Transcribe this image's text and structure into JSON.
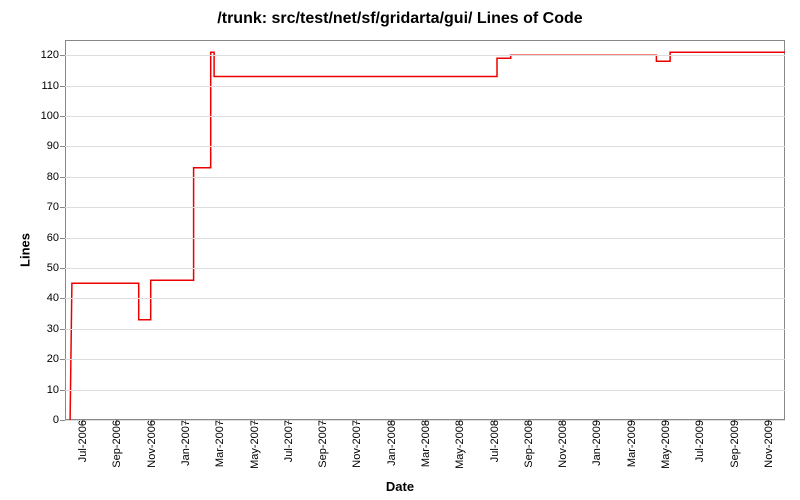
{
  "chart_data": {
    "type": "line",
    "title": "/trunk: src/test/net/sf/gridarta/gui/ Lines of Code",
    "xlabel": "Date",
    "ylabel": "Lines",
    "ylim": [
      0,
      125
    ],
    "yticks": [
      0,
      10,
      20,
      30,
      40,
      50,
      60,
      70,
      80,
      90,
      100,
      110,
      120
    ],
    "xticks": [
      "Jul-2006",
      "Sep-2006",
      "Nov-2006",
      "Jan-2007",
      "Mar-2007",
      "May-2007",
      "Jul-2007",
      "Sep-2007",
      "Nov-2007",
      "Jan-2008",
      "Mar-2008",
      "May-2008",
      "Jul-2008",
      "Sep-2008",
      "Nov-2008",
      "Jan-2009",
      "Mar-2009",
      "May-2009",
      "Jul-2009",
      "Sep-2009",
      "Nov-2009"
    ],
    "x_range": [
      0,
      42
    ],
    "series": [
      {
        "name": "Lines of Code",
        "points": [
          {
            "x": 0.3,
            "y": 0
          },
          {
            "x": 0.4,
            "y": 45
          },
          {
            "x": 4.3,
            "y": 45
          },
          {
            "x": 4.3,
            "y": 33
          },
          {
            "x": 5.0,
            "y": 33
          },
          {
            "x": 5.0,
            "y": 46
          },
          {
            "x": 7.5,
            "y": 46
          },
          {
            "x": 7.5,
            "y": 83
          },
          {
            "x": 8.5,
            "y": 83
          },
          {
            "x": 8.5,
            "y": 121
          },
          {
            "x": 8.7,
            "y": 121
          },
          {
            "x": 8.7,
            "y": 113
          },
          {
            "x": 25.2,
            "y": 113
          },
          {
            "x": 25.2,
            "y": 119
          },
          {
            "x": 26.0,
            "y": 119
          },
          {
            "x": 26.0,
            "y": 120
          },
          {
            "x": 34.5,
            "y": 120
          },
          {
            "x": 34.5,
            "y": 118
          },
          {
            "x": 35.3,
            "y": 118
          },
          {
            "x": 35.3,
            "y": 121
          },
          {
            "x": 42.0,
            "y": 121
          }
        ]
      }
    ]
  }
}
